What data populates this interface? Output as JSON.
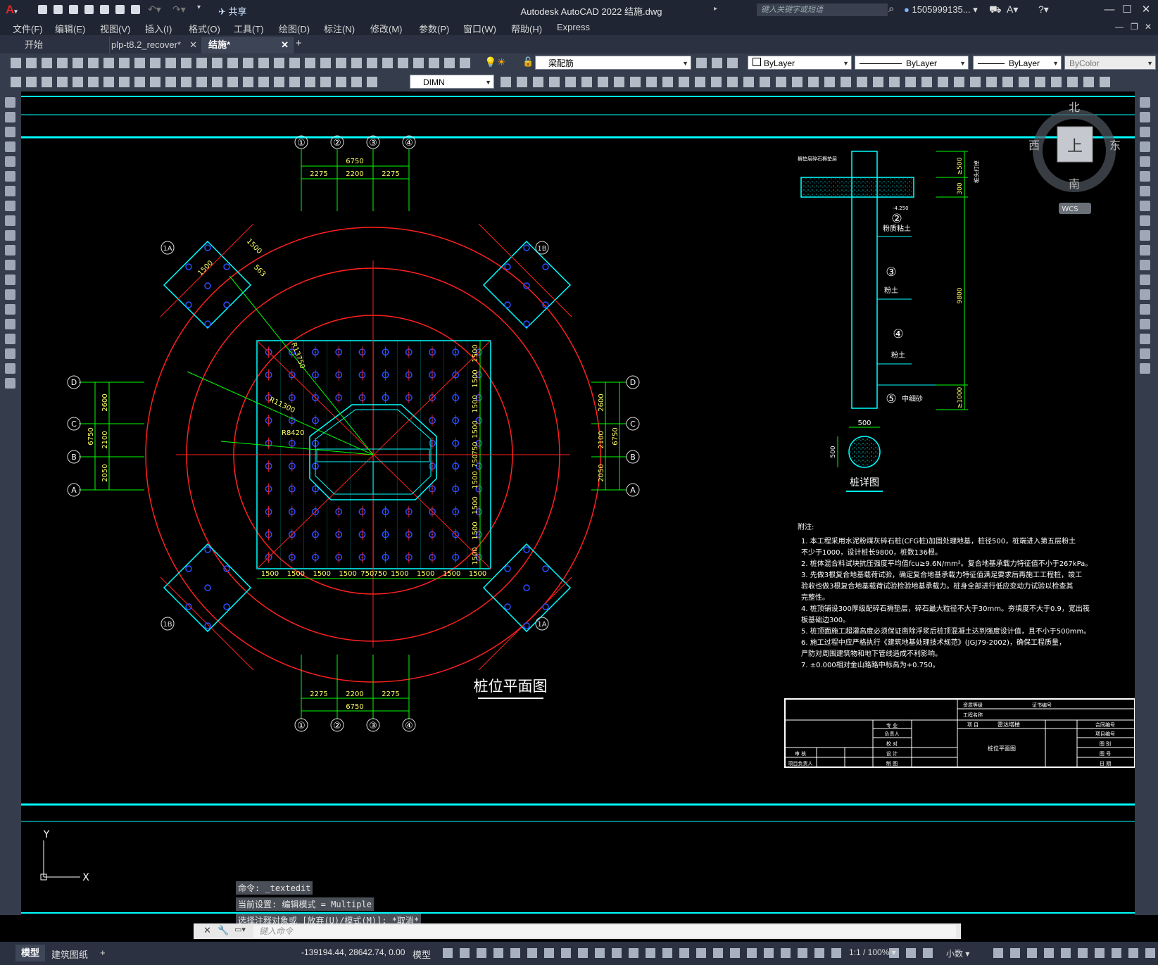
{
  "title_bar": {
    "app_title": "Autodesk AutoCAD 2022    结施.dwg",
    "share_label": "共享",
    "search_placeholder": "键入关键字或短语",
    "user_name": "1505999135...",
    "minimize": "—",
    "maximize": "☐",
    "close": "✕"
  },
  "menu": {
    "items": [
      "文件(F)",
      "编辑(E)",
      "视图(V)",
      "插入(I)",
      "格式(O)",
      "工具(T)",
      "绘图(D)",
      "标注(N)",
      "修改(M)",
      "参数(P)",
      "窗口(W)",
      "帮助(H)",
      "Express"
    ]
  },
  "tabs": {
    "items": [
      "开始",
      "plp-t8.2_recover*",
      "结施*"
    ],
    "add": "+"
  },
  "toolbar": {
    "layer_name": "梁配筋",
    "color": "ByLayer",
    "linetype": "ByLayer",
    "lineweight": "ByLayer",
    "plotstyle": "ByColor",
    "dimstyle": "DIMN"
  },
  "viewcube": {
    "north": "北",
    "south": "南",
    "east": "东",
    "west": "西",
    "top": "上",
    "wcs": "WCS"
  },
  "drawing": {
    "grid_top": [
      "①",
      "②",
      "③",
      "④"
    ],
    "grid_left": [
      "D",
      "C",
      "B",
      "A"
    ],
    "corner_labels": [
      "1A",
      "1B",
      "1B",
      "1A"
    ],
    "dim_top_total": "6750",
    "dim_top_parts": [
      "2275",
      "2200",
      "2275"
    ],
    "dim_left_total": "6750",
    "dim_left_parts": [
      "2600",
      "2100",
      "2050"
    ],
    "dim_bottom_row": [
      "1500",
      "1500",
      "1500",
      "1500",
      "750",
      "750",
      "1500",
      "1500",
      "1500",
      "1500"
    ],
    "dim_right_col": [
      "1500",
      "1500",
      "1500",
      "1500",
      "750",
      "750",
      "1500",
      "1500",
      "1500",
      "1500"
    ],
    "dim_rotated": [
      "1500",
      "1500",
      "563"
    ],
    "radii": [
      "R13750",
      "R11300",
      "R8420"
    ],
    "plan_title": "桩位平面图",
    "pile_title": "桩详图",
    "pile_top_label": "褥垫层碎石褥垫层",
    "pile_elev": "-4.250",
    "pile_dim_500": "500",
    "pile_dim_300": "300",
    "pile_dim_9800": "9800",
    "pile_dim_1000": "≥1000",
    "pile_dim_500v": "≥500",
    "pile_cap_label": "桩头打掉",
    "soil_layers": [
      {
        "num": "②",
        "name": "粉质粘土"
      },
      {
        "num": "③",
        "name": "粉土"
      },
      {
        "num": "④",
        "name": "粉土"
      },
      {
        "num": "⑤",
        "name": "中细砂"
      }
    ],
    "notes_title": "附注:",
    "notes": [
      "1. 本工程采用水泥粉煤灰碎石桩(CFG桩)加固处理地基，桩径500，桩端进入第五层粉土",
      "   不少于1000，设计桩长9800，桩数136根。",
      "2. 桩体混合料试块抗压强度平均值fcu≥9.6N/mm²。复合地基承载力特征值不小于267kPa。",
      "3. 先做3根复合地基载荷试验，确定复合地基承载力特征值满足要求后再施工工程桩，竣工",
      "   验收也做3根复合地基载荷试验检验地基承载力。桩身全部进行低应变动力试验以检查其",
      "   完整性。",
      "4. 桩顶铺设300厚级配碎石褥垫层，碎石最大粒径不大于30mm。夯填度不大于0.9，宽出筏",
      "   板基础边300。",
      "5. 桩顶面施工超灌高度必须保证凿除浮浆后桩顶混凝土达到强度设计值，且不小于500mm。",
      "6. 施工过程中应严格执行《建筑地基处理技术规范》(JGJ79-2002)，确保工程质量，",
      "   严防对周围建筑物和地下管线造成不利影响。",
      "7. ±0.000相对金山路路中标高为+0.750。"
    ],
    "titleblock": {
      "project_label": "工程名称",
      "drawing_name": "桩位平面图",
      "item_name": "雷达塔楼",
      "rows_left": [
        "专 业",
        "负责人",
        "校 对",
        "设 计",
        "制 图"
      ],
      "rows_left2": [
        "审 核",
        "项目负责人"
      ],
      "rows_right": [
        "合同编号",
        "项目编号",
        "图 别",
        "图 号",
        "日 期"
      ],
      "top_labels": [
        "资质等级",
        "证书编号",
        "项 目"
      ]
    }
  },
  "command": {
    "history": [
      "命令: _textedit",
      "当前设置: 编辑模式 = Multiple",
      "选择注释对象或 [放弃(U)/模式(M)]: *取消*"
    ],
    "placeholder": "键入命令"
  },
  "ucs": {
    "x": "X",
    "y": "Y"
  },
  "status": {
    "model_tab": "模型",
    "layout_tab": "建筑图纸",
    "add": "+",
    "coords": "-139194.44, 28642.74, 0.00",
    "space": "模型",
    "scale": "1:1 / 100%",
    "units": "小数"
  },
  "colors": {
    "canvas": "#000000",
    "cyan": "#00ffff",
    "green": "#00ff00",
    "red": "#ff0000",
    "yellow": "#ffff00",
    "blue": "#0000ff",
    "ui_dark": "#1f2532",
    "ui_panel": "#353c4b"
  }
}
